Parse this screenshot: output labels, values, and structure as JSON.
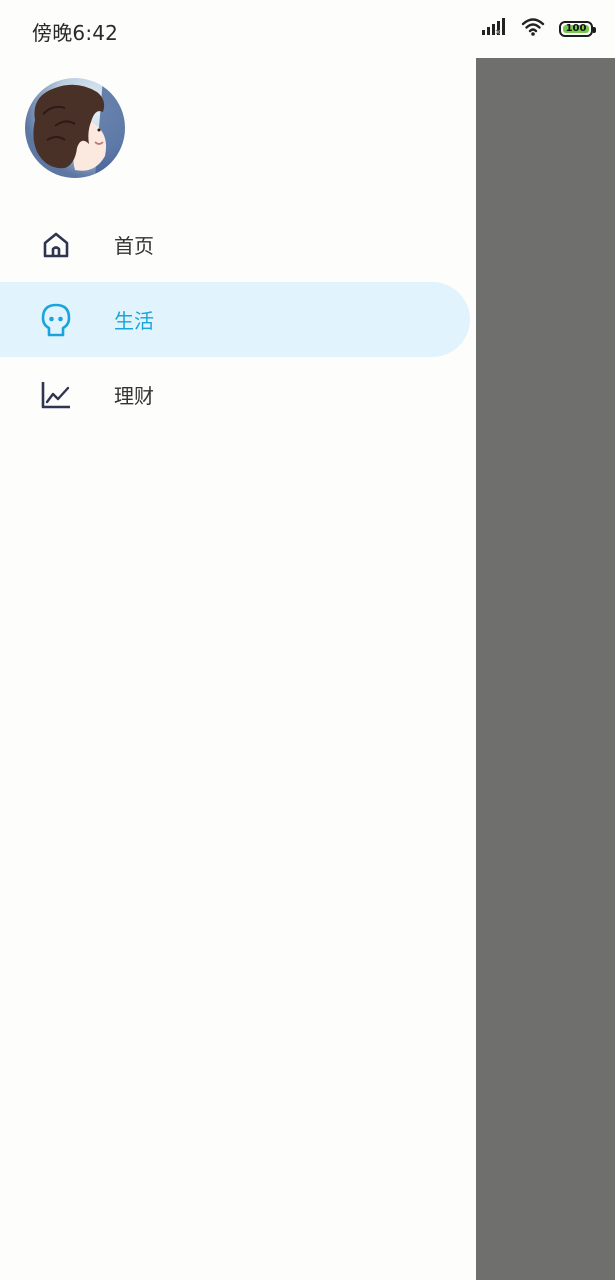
{
  "status_bar": {
    "time": "傍晚6:42",
    "battery": "100",
    "icons": [
      "signal-icon",
      "wifi-icon",
      "battery-icon"
    ]
  },
  "drawer": {
    "avatar": "avatar-icon",
    "menu": [
      {
        "label": "首页",
        "icon": "home-icon",
        "selected": false
      },
      {
        "label": "生活",
        "icon": "life-icon",
        "selected": true
      },
      {
        "label": "理财",
        "icon": "chart-line-icon",
        "selected": false
      }
    ]
  },
  "colors": {
    "accent": "#1aa4dc",
    "selected_bg": "#e1f3fc",
    "icon_dark": "#2f3450",
    "scrim": "#6f706e",
    "battery_green": "#78c850"
  }
}
